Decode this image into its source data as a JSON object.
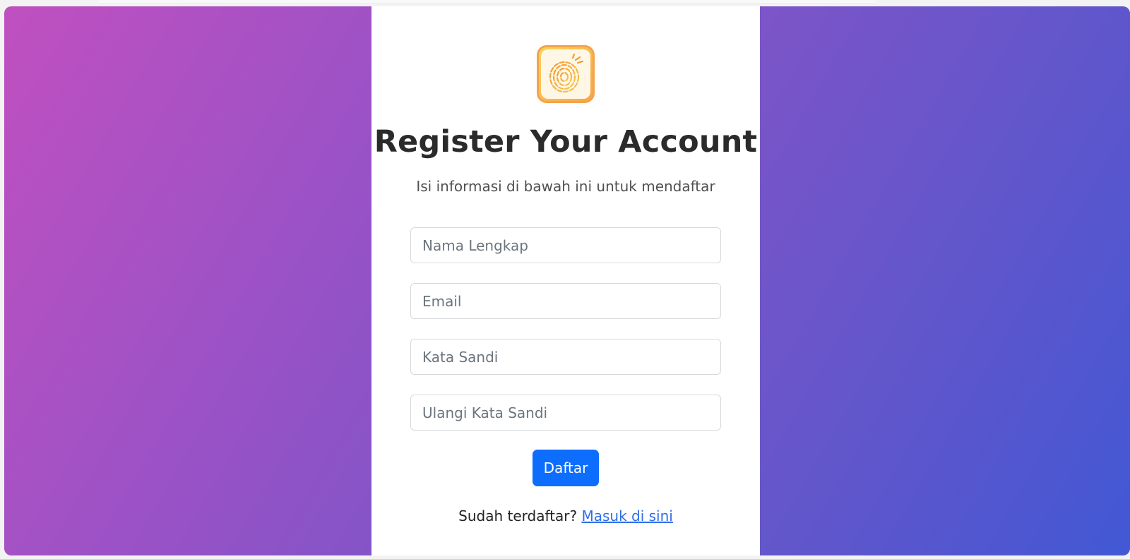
{
  "page": {
    "title": "Register Your Account",
    "subtitle": "Isi informasi di bawah ini untuk mendaftar"
  },
  "form": {
    "full_name_placeholder": "Nama Lengkap",
    "email_placeholder": "Email",
    "password_placeholder": "Kata Sandi",
    "confirm_password_placeholder": "Ulangi Kata Sandi",
    "submit_label": "Daftar"
  },
  "footer": {
    "prompt": "Sudah terdaftar?",
    "login_link": "Masuk di sini"
  },
  "icons": {
    "logo": "fingerprint-icon"
  },
  "colors": {
    "primary": "#0d6efd",
    "link": "#2f6fe8",
    "gradient_start": "#c050c0",
    "gradient_end": "#4158d4",
    "logo_accent": "#f6a54b"
  }
}
